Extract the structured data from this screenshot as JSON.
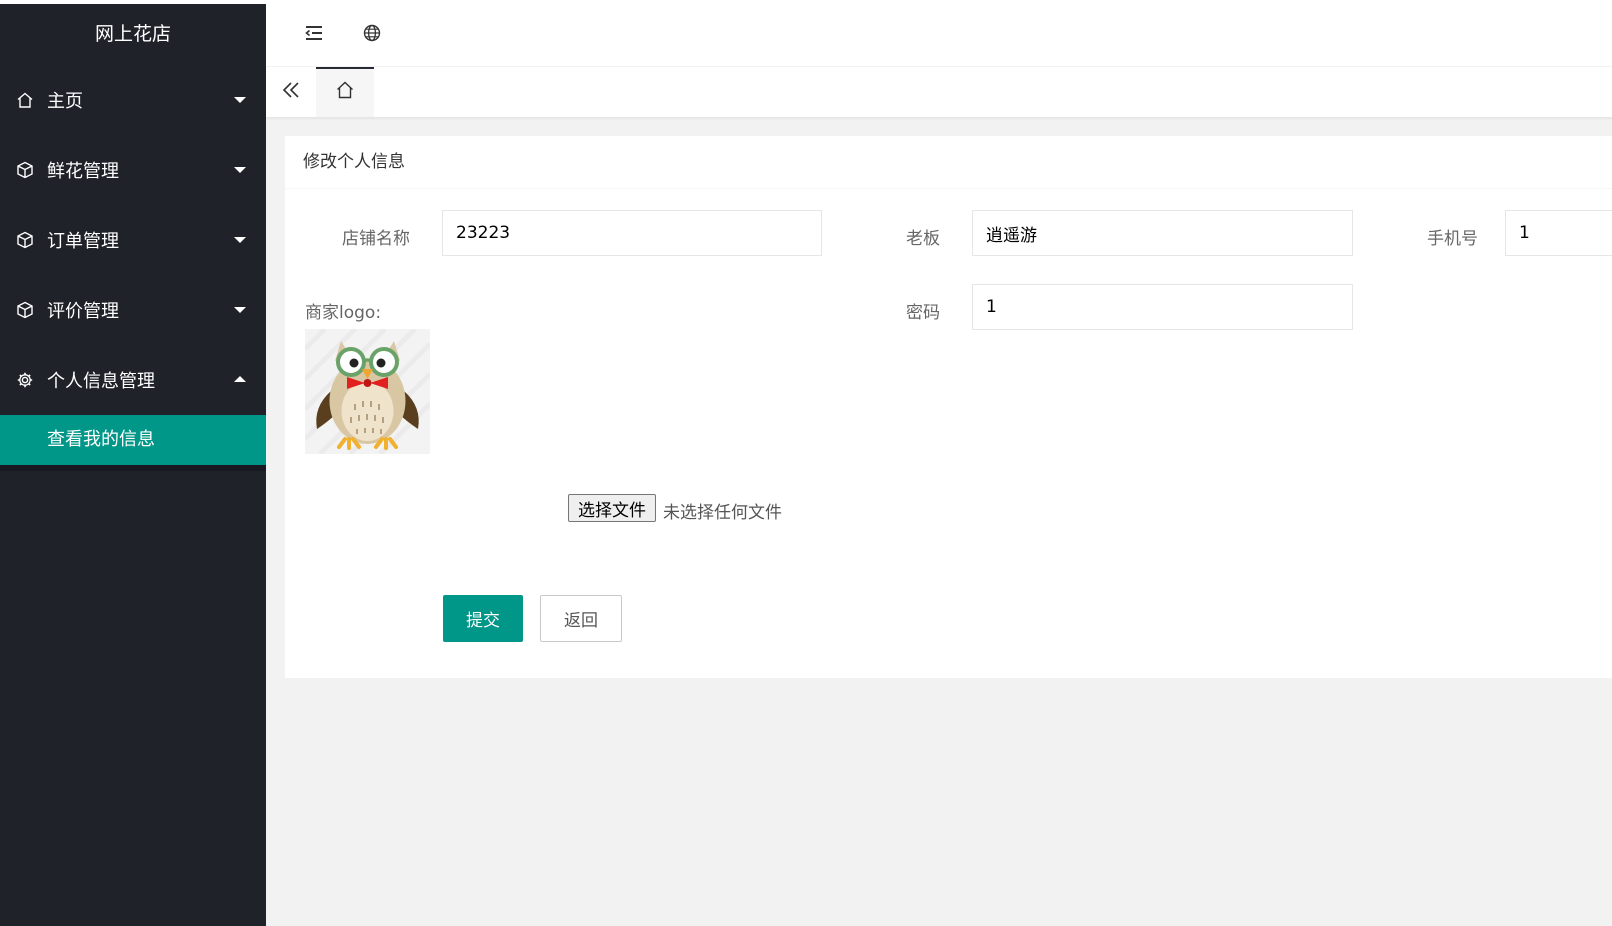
{
  "app": {
    "title": "网上花店"
  },
  "sidebar": {
    "items": [
      {
        "label": "主页",
        "icon": "home-icon"
      },
      {
        "label": "鲜花管理",
        "icon": "cube-icon"
      },
      {
        "label": "订单管理",
        "icon": "cube-icon"
      },
      {
        "label": "评价管理",
        "icon": "cube-icon"
      },
      {
        "label": "个人信息管理",
        "icon": "gear-icon",
        "expanded": true
      }
    ],
    "subitems": [
      {
        "label": "查看我的信息",
        "active": true
      }
    ]
  },
  "header": {
    "icons": [
      "menu-collapse-icon",
      "globe-icon"
    ]
  },
  "tabs": {
    "icons": [
      "double-chevron-left-icon",
      "home-icon"
    ]
  },
  "card": {
    "title": "修改个人信息"
  },
  "form": {
    "shop_name": {
      "label": "店铺名称",
      "value": "23223"
    },
    "boss": {
      "label": "老板",
      "value": "逍遥游"
    },
    "phone": {
      "label": "手机号",
      "value": "1"
    },
    "logo": {
      "label": "商家logo:"
    },
    "password": {
      "label": "密码",
      "value": "1"
    },
    "file": {
      "button": "选择文件",
      "status": "未选择任何文件"
    },
    "submit": "提交",
    "back": "返回"
  },
  "colors": {
    "accent": "#009688",
    "sidebar_bg": "#20222a",
    "page_bg": "#f2f2f2"
  }
}
